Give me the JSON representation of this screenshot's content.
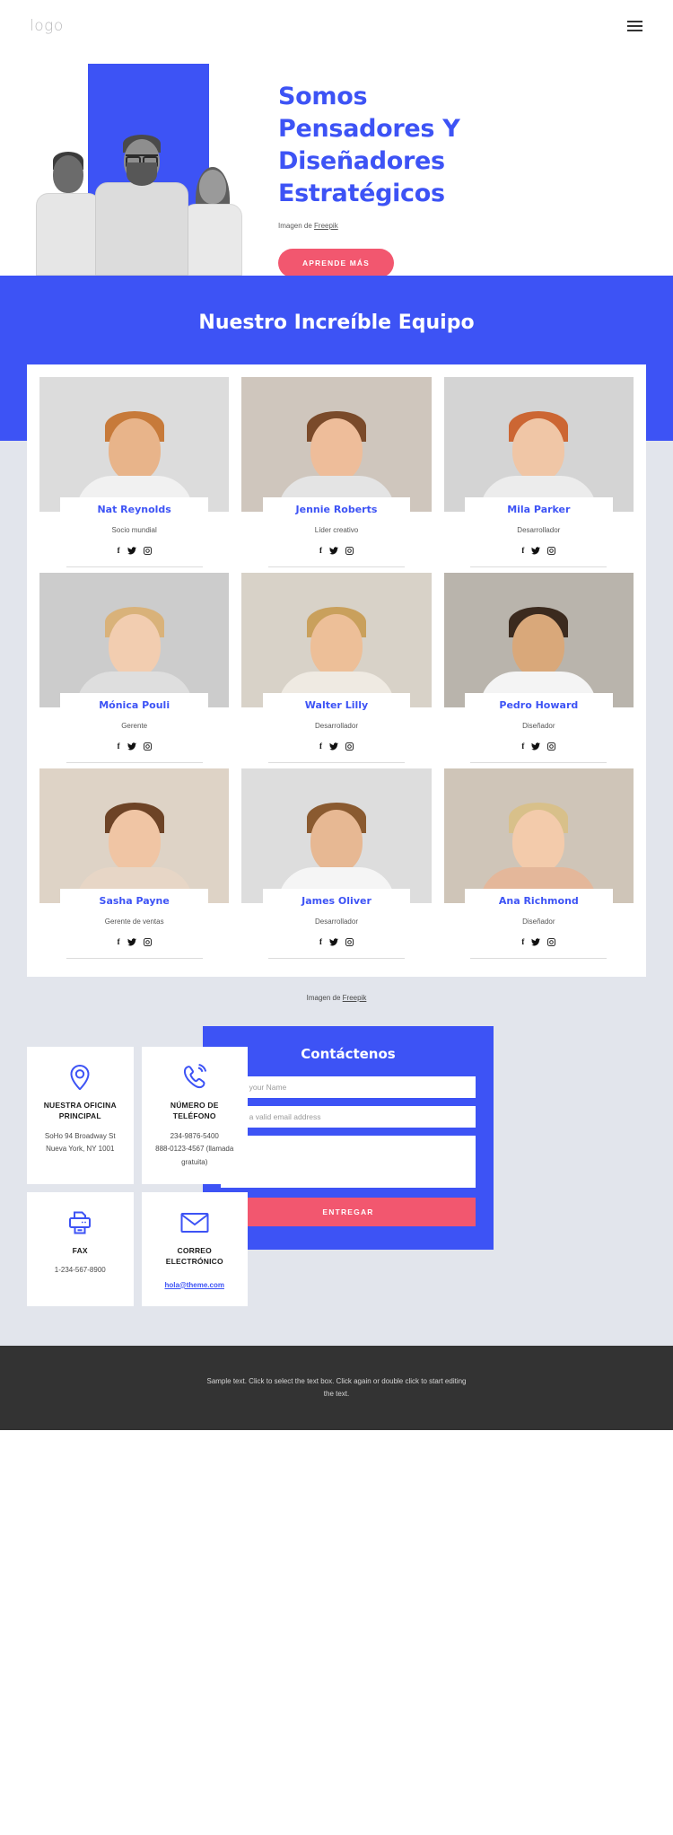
{
  "header": {
    "logo": "logo",
    "menu_icon": "hamburger-icon"
  },
  "hero": {
    "title": "Somos Pensadores Y Diseñadores Estratégicos",
    "credit_prefix": "Imagen de ",
    "credit_link": "Freepik",
    "cta_label": "APRENDE MÁS",
    "accent_blue": "#3d53f5",
    "accent_pink": "#f2576f"
  },
  "team": {
    "heading": "Nuestro Increíble Equipo",
    "credit_prefix": "Imagen de ",
    "credit_link": "Freepik",
    "social": {
      "facebook": "f",
      "twitter": "🐦",
      "instagram": "▣"
    },
    "members": [
      {
        "name": "Nat Reynolds",
        "role": "Socio mundial",
        "skin": "#e8b48a",
        "hair": "#c77a3a",
        "cloth": "#f1f1f1",
        "bg": "#dcdcdc"
      },
      {
        "name": "Jennie Roberts",
        "role": "Líder creativo",
        "skin": "#eebd9a",
        "hair": "#7a4a2a",
        "cloth": "#e4e4e4",
        "bg": "#cfc6bd"
      },
      {
        "name": "Mila Parker",
        "role": "Desarrollador",
        "skin": "#f0c6a6",
        "hair": "#cc6633",
        "cloth": "#ececec",
        "bg": "#d4d4d4"
      },
      {
        "name": "Mónica Pouli",
        "role": "Gerente",
        "skin": "#f2cdb0",
        "hair": "#d9b27a",
        "cloth": "#dedede",
        "bg": "#cccccc"
      },
      {
        "name": "Walter Lilly",
        "role": "Desarrollador",
        "skin": "#edbf98",
        "hair": "#c9a05c",
        "cloth": "#efeae2",
        "bg": "#d8d2c8"
      },
      {
        "name": "Pedro Howard",
        "role": "Diseñador",
        "skin": "#d9a87a",
        "hair": "#3b2a1e",
        "cloth": "#f4f4f4",
        "bg": "#b9b4ac"
      },
      {
        "name": "Sasha Payne",
        "role": "Gerente de ventas",
        "skin": "#f0c5a4",
        "hair": "#6d4326",
        "cloth": "#e7d6c6",
        "bg": "#ded3c6"
      },
      {
        "name": "James Oliver",
        "role": "Desarrollador",
        "skin": "#e7b893",
        "hair": "#8a5a30",
        "cloth": "#f5f5f5",
        "bg": "#dddddd"
      },
      {
        "name": "Ana Richmond",
        "role": "Diseñador",
        "skin": "#f3cbab",
        "hair": "#d8c08a",
        "cloth": "#e4b79a",
        "bg": "#cfc5b8"
      }
    ]
  },
  "contact": {
    "cards": [
      {
        "icon": "location-pin-icon",
        "title": "NUESTRA OFICINA PRINCIPAL",
        "lines": [
          "SoHo 94 Broadway St",
          "Nueva York, NY 1001"
        ]
      },
      {
        "icon": "phone-icon",
        "title": "NÚMERO DE TELÉFONO",
        "lines": [
          "234-9876-5400",
          "888-0123-4567 (llamada gratuita)"
        ]
      },
      {
        "icon": "fax-printer-icon",
        "title": "FAX",
        "lines": [
          "1-234-567-8900"
        ]
      },
      {
        "icon": "envelope-icon",
        "title": "CORREO ELECTRÓNICO",
        "lines": [],
        "link": "hola@theme.com"
      }
    ],
    "form": {
      "title": "Contáctenos",
      "name_placeholder": "Enter your Name",
      "name_value": "",
      "email_placeholder": "Enter a valid email address",
      "email_value": "",
      "message_placeholder": "",
      "message_value": "",
      "submit_label": "ENTREGAR"
    }
  },
  "footer": {
    "text": "Sample text. Click to select the text box. Click again or double click to start editing the text."
  }
}
